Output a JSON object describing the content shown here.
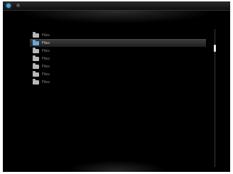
{
  "files": [
    {
      "label": "Files",
      "selected": false
    },
    {
      "label": "Files",
      "selected": true
    },
    {
      "label": "Files",
      "selected": false
    },
    {
      "label": "Files",
      "selected": false
    },
    {
      "label": "Files",
      "selected": false
    },
    {
      "label": "Files",
      "selected": false
    },
    {
      "label": "Files",
      "selected": false
    }
  ],
  "colors": {
    "background": "#000000",
    "selection_icon": "#6aa8d8",
    "app_icon": "#4aa3d8"
  },
  "icons": {
    "app": "app-icon",
    "folder": "folder-icon"
  }
}
